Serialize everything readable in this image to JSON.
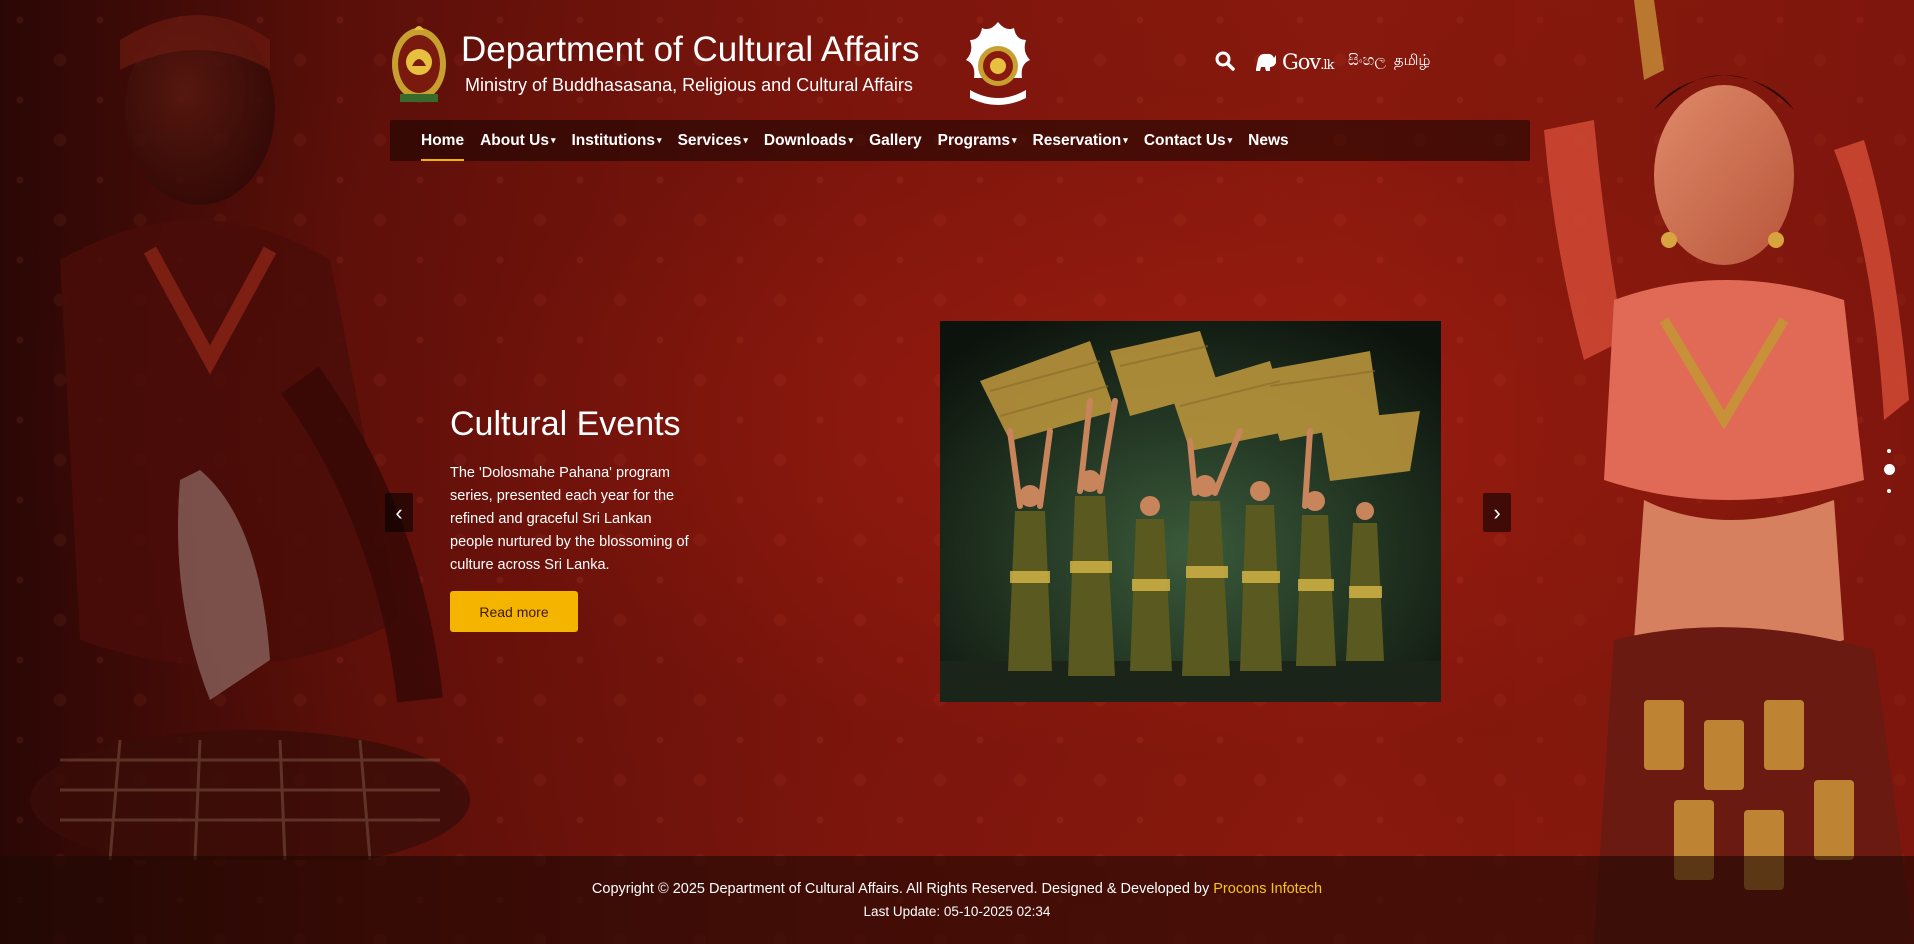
{
  "header": {
    "title": "Department of Cultural Affairs",
    "subtitle": "Ministry of Buddhasasana, Religious and Cultural Affairs",
    "govlk_label": "Gov",
    "govlk_suffix": ".lk",
    "languages": [
      "සිංහල",
      "தமிழ்"
    ]
  },
  "nav": {
    "items": [
      {
        "label": "Home",
        "dropdown": false,
        "active": true
      },
      {
        "label": "About Us",
        "dropdown": true
      },
      {
        "label": "Institutions",
        "dropdown": true
      },
      {
        "label": "Services",
        "dropdown": true
      },
      {
        "label": "Downloads",
        "dropdown": true
      },
      {
        "label": "Gallery",
        "dropdown": false
      },
      {
        "label": "Programs",
        "dropdown": true
      },
      {
        "label": "Reservation",
        "dropdown": true
      },
      {
        "label": "Contact Us",
        "dropdown": true
      },
      {
        "label": "News",
        "dropdown": false
      }
    ],
    "caret": "▾"
  },
  "slider": {
    "title": "Cultural Events",
    "text": "The 'Dolosmahe Pahana' program series, presented each year for the refined and graceful Sri Lankan people nurtured by the blossoming of culture across Sri Lanka.",
    "button_label": "Read more",
    "prev_label": "‹",
    "next_label": "›",
    "active_slide": 2,
    "slide_count": 3
  },
  "footer": {
    "copyright": "Copyright © 2025 Department of Cultural Affairs. All Rights Reserved. Designed & Developed by",
    "developer": "Procons Infotech",
    "last_update": "Last Update: 05-10-2025 02:34"
  },
  "colors": {
    "accent": "#f5b400",
    "developer_link": "#f5c518",
    "background": "#7d160d"
  }
}
